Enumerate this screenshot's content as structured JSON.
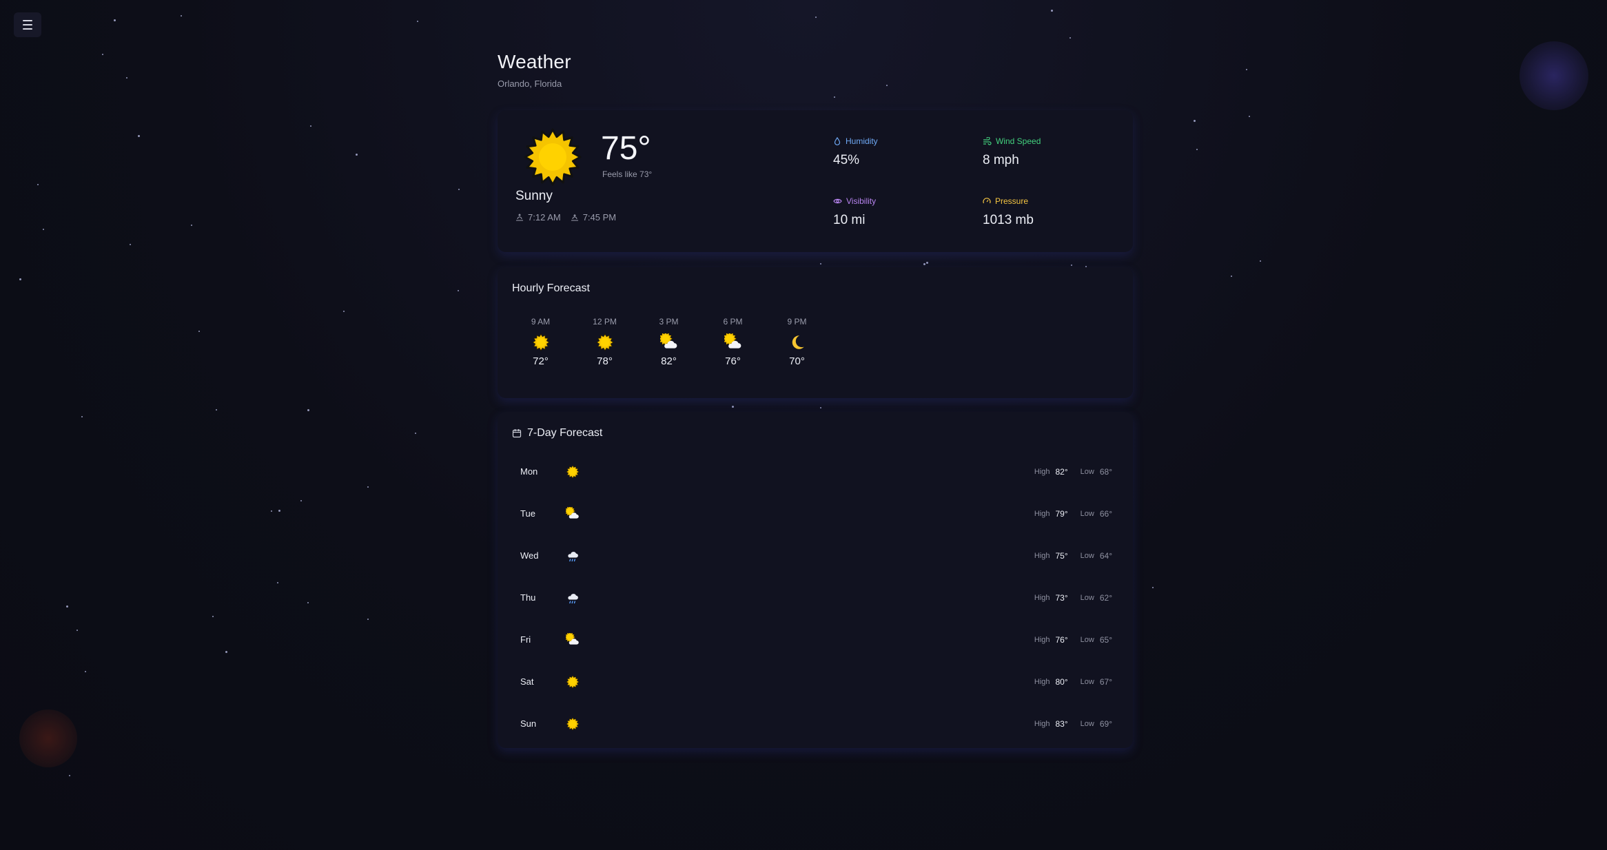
{
  "header": {
    "title": "Weather",
    "location": "Orlando, Florida"
  },
  "current": {
    "temp": "75°",
    "feels_like": "Feels like 73°",
    "condition": "Sunny",
    "sunrise": "7:12 AM",
    "sunset": "7:45 PM",
    "icon": "sun-icon",
    "metrics": {
      "humidity": {
        "label": "Humidity",
        "value": "45%",
        "color": "#6fa9f5",
        "icon": "droplet-icon"
      },
      "wind": {
        "label": "Wind Speed",
        "value": "8 mph",
        "color": "#43d17e",
        "icon": "wind-icon"
      },
      "visibility": {
        "label": "Visibility",
        "value": "10 mi",
        "color": "#b784ef",
        "icon": "eye-icon"
      },
      "pressure": {
        "label": "Pressure",
        "value": "1013 mb",
        "color": "#f5c542",
        "icon": "gauge-icon"
      }
    }
  },
  "hourly": {
    "title": "Hourly Forecast",
    "items": [
      {
        "time": "9 AM",
        "temp": "72°",
        "icon": "sun"
      },
      {
        "time": "12 PM",
        "temp": "78°",
        "icon": "sun"
      },
      {
        "time": "3 PM",
        "temp": "82°",
        "icon": "sun-cloud"
      },
      {
        "time": "6 PM",
        "temp": "76°",
        "icon": "sun-cloud"
      },
      {
        "time": "9 PM",
        "temp": "70°",
        "icon": "moon"
      }
    ]
  },
  "weekly": {
    "title": "7-Day Forecast",
    "high_label": "High",
    "low_label": "Low",
    "days": [
      {
        "day": "Mon",
        "icon": "sun",
        "high": "82°",
        "low": "68°"
      },
      {
        "day": "Tue",
        "icon": "sun-cloud",
        "high": "79°",
        "low": "66°"
      },
      {
        "day": "Wed",
        "icon": "rain-cloud",
        "high": "75°",
        "low": "64°"
      },
      {
        "day": "Thu",
        "icon": "rain-cloud",
        "high": "73°",
        "low": "62°"
      },
      {
        "day": "Fri",
        "icon": "sun-cloud",
        "high": "76°",
        "low": "65°"
      },
      {
        "day": "Sat",
        "icon": "sun",
        "high": "80°",
        "low": "67°"
      },
      {
        "day": "Sun",
        "icon": "sun",
        "high": "83°",
        "low": "69°"
      }
    ]
  }
}
